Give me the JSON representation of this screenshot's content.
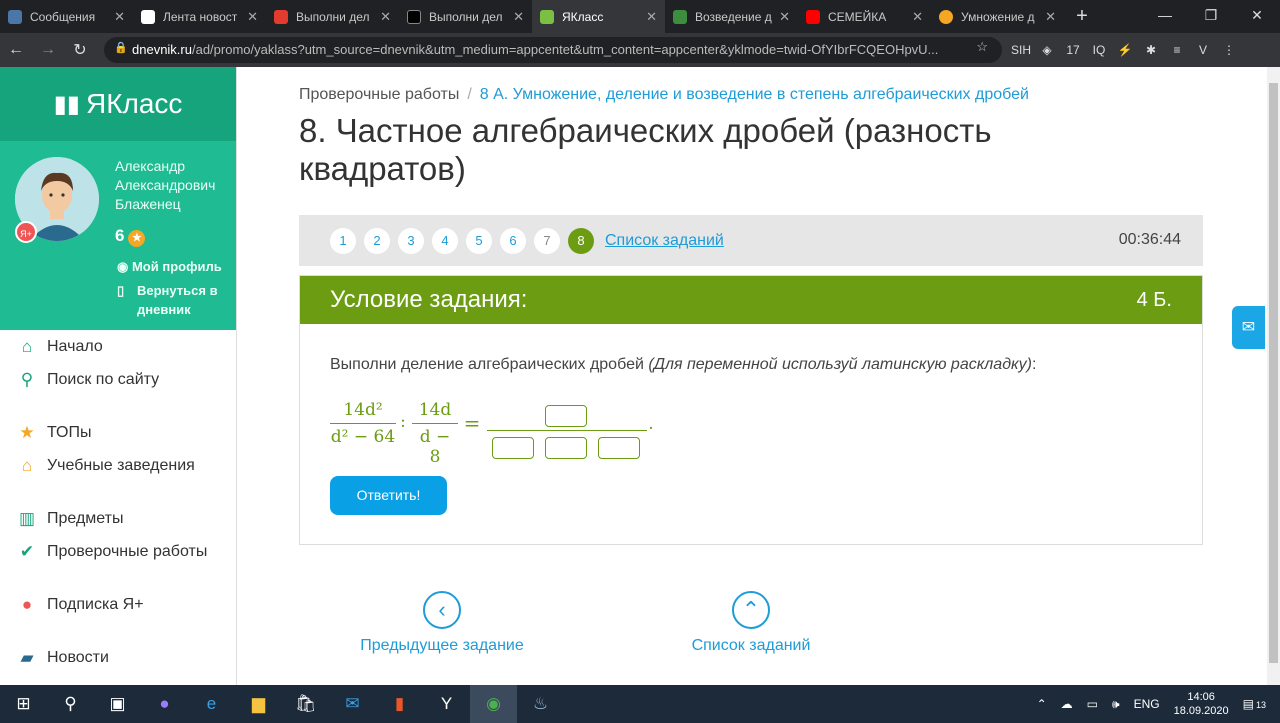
{
  "browser": {
    "tabs": [
      {
        "title": "Сообщения",
        "color": "#4a76a8"
      },
      {
        "title": "Лента новост",
        "color": "#ffffff"
      },
      {
        "title": "Выполни дел",
        "color": "#e33b2e"
      },
      {
        "title": "Выполни дел",
        "color": "#000000"
      },
      {
        "title": "ЯКласс",
        "color": "#7bc043"
      },
      {
        "title": "Возведение д",
        "color": "#3c8e3e"
      },
      {
        "title": "СЕМЕЙКА",
        "color": "#ff0000"
      },
      {
        "title": "Умножение д",
        "color": "#f5a623"
      }
    ],
    "url_host": "dnevnik.ru",
    "url_rest": "/ad/promo/yaklass?utm_source=dnevnik&utm_medium=appcentet&utm_content=appcenter&yklmode=twid-OfYIbrFCQEOHpvU...",
    "new_tab": "+",
    "extensions": [
      "SIH",
      "◈",
      "17",
      "IQ",
      "⚡",
      "✱",
      "≡",
      "V"
    ]
  },
  "sidebar": {
    "logo": "ЯКласс",
    "user": {
      "name": "Александр Александрович Блаженец",
      "score": "6",
      "badge": "Я+",
      "my_profile": "Мой профиль",
      "back_to_diary": "Вернуться в дневник"
    },
    "menu": [
      {
        "label": "Начало",
        "icon": "home-icon"
      },
      {
        "label": "Поиск по сайту",
        "icon": "search-icon"
      },
      {
        "label": "ТОПы",
        "icon": "star-icon"
      },
      {
        "label": "Учебные заведения",
        "icon": "institution-icon"
      },
      {
        "label": "Предметы",
        "icon": "books-icon"
      },
      {
        "label": "Проверочные работы",
        "icon": "check-icon"
      },
      {
        "label": "Подписка Я+",
        "icon": "subscription-icon"
      },
      {
        "label": "Новости",
        "icon": "news-icon"
      }
    ]
  },
  "main": {
    "breadcrumb_root": "Проверочные работы",
    "breadcrumb_current": "8 А. Умножение, деление и возведение в степень алгебраических дробей",
    "title": "8. Частное алгебраических дробей (разность квадратов)",
    "pages": [
      "1",
      "2",
      "3",
      "4",
      "5",
      "6",
      "7",
      "8"
    ],
    "current_page": 8,
    "task_list_link": "Список заданий",
    "timer": "00:36:44",
    "condition_header": "Условие задания:",
    "points": "4 Б.",
    "condition_text": "Выполни деление алгебраических дробей",
    "condition_hint": "(Для переменной используй латинскую раскладку)",
    "condition_colon": ":",
    "math": {
      "frac1_num": "14d²",
      "frac1_den": "d² − 64",
      "op": ":",
      "frac2_num": "14d",
      "frac2_den": "d − 8",
      "equals": "=",
      "period": "."
    },
    "answer_button": "Ответить!",
    "prev_task": "Предыдущее задание",
    "task_list_bottom": "Список заданий"
  },
  "taskbar": {
    "lang": "ENG",
    "time": "14:06",
    "date": "18.09.2020",
    "notifications": "13"
  }
}
